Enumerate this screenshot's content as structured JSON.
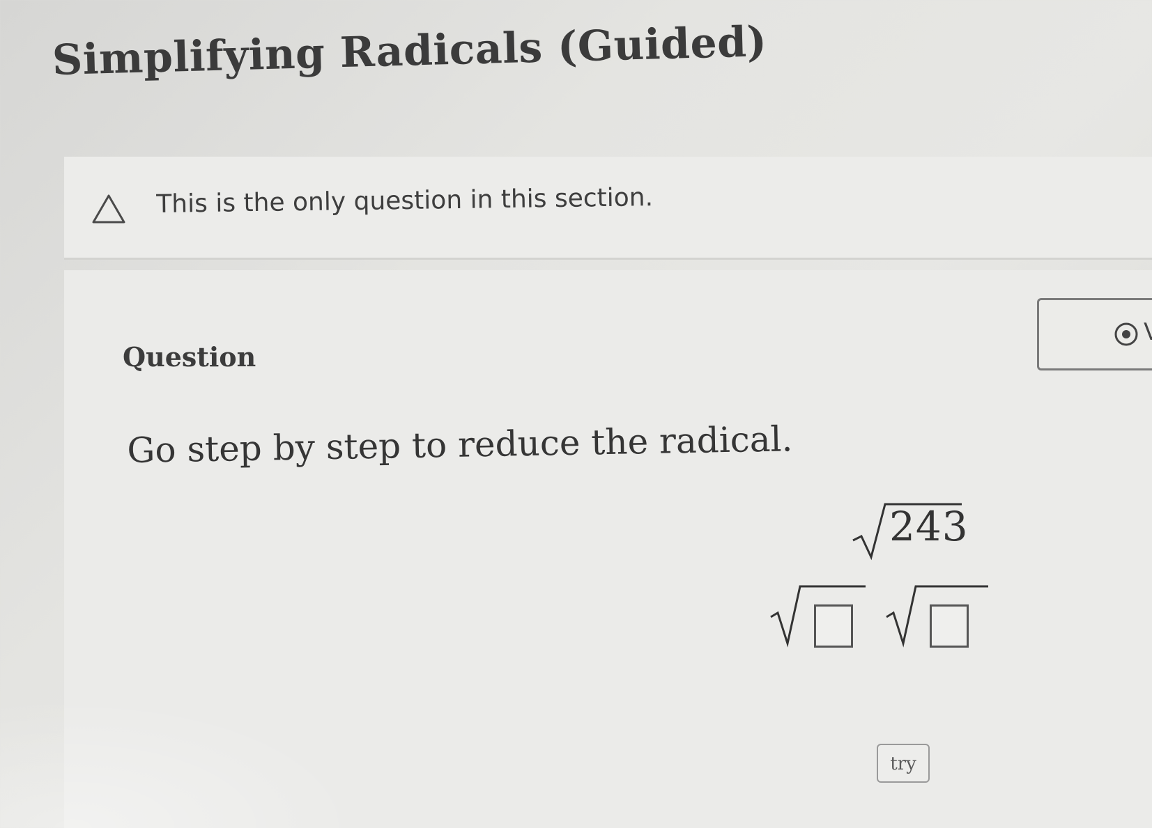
{
  "page": {
    "title": "Simplifying Radicals (Guided)"
  },
  "notice": {
    "icon": "warning-icon",
    "text": "This is the only question in this section."
  },
  "question": {
    "heading": "Question",
    "prompt": "Go step by step to reduce the radical.",
    "radicand": "243",
    "answer_inputs": [
      {
        "value": "",
        "placeholder": ""
      },
      {
        "value": "",
        "placeholder": ""
      }
    ],
    "try_button_label": "try"
  },
  "side_panel": {
    "icon": "record-icon",
    "label": "V"
  }
}
